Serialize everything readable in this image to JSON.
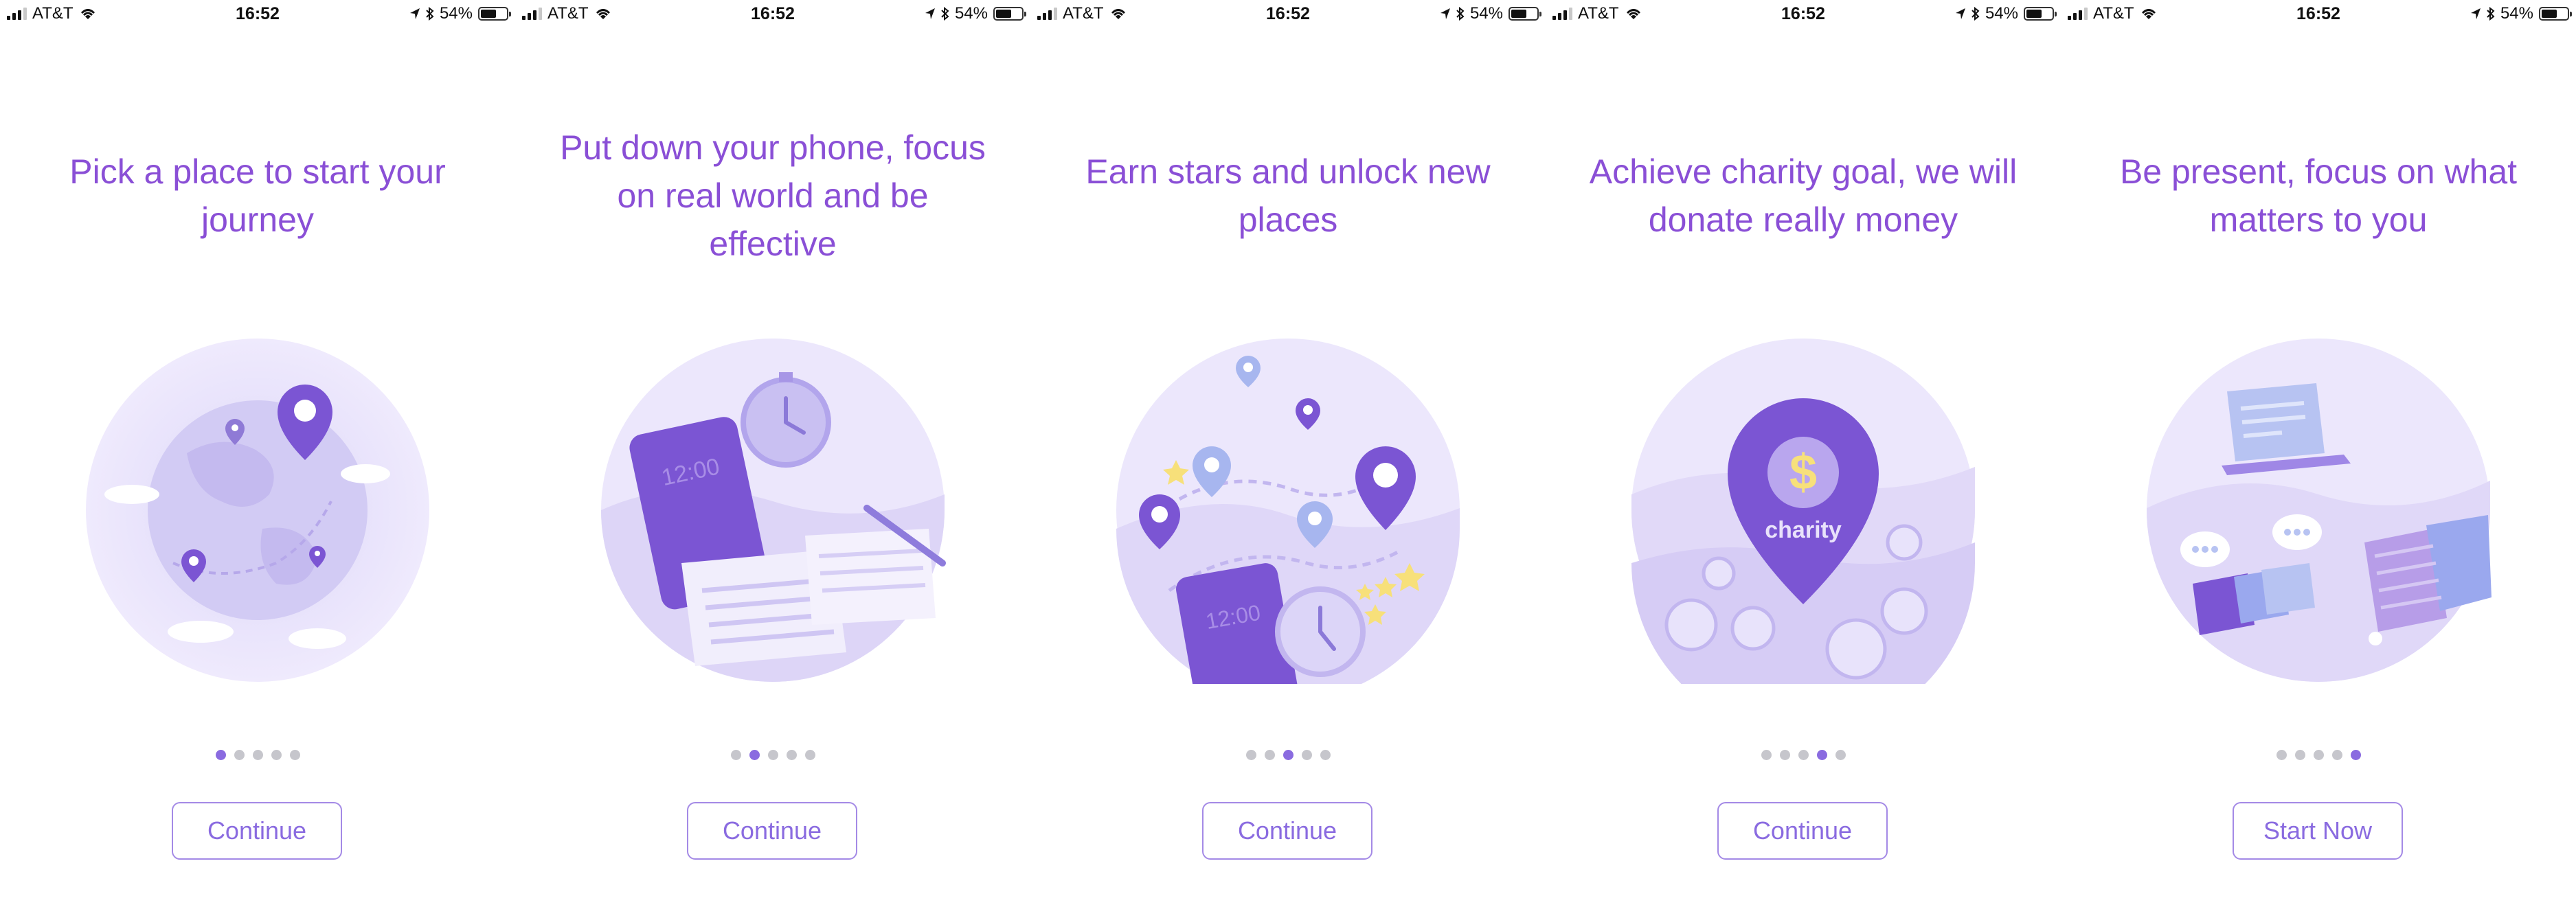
{
  "status_bar": {
    "carrier": "AT&T",
    "time": "16:52",
    "battery": "54%",
    "battery_level": 0.54,
    "icons": [
      "signal-icon",
      "wifi-icon",
      "location-arrow-icon",
      "bluetooth-icon",
      "battery-icon"
    ]
  },
  "screens": [
    {
      "title": "Pick a place to start your journey",
      "illustration": "globe-with-pins",
      "active_dot": 0,
      "button_label": "Continue"
    },
    {
      "title": "Put down your phone, focus on real world and be effective",
      "illustration": "phone-and-stopwatch",
      "phone_text": "12:00",
      "active_dot": 1,
      "button_label": "Continue"
    },
    {
      "title": "Earn stars and unlock new places",
      "illustration": "map-pins-and-stars",
      "phone_text": "12:00",
      "active_dot": 2,
      "button_label": "Continue"
    },
    {
      "title": "Achieve charity goal, we will donate really money",
      "illustration": "charity-pin",
      "pin_symbol": "$",
      "pin_label": "charity",
      "active_dot": 3,
      "button_label": "Continue"
    },
    {
      "title": "Be present, focus on what matters to you",
      "illustration": "laptop-and-coffee",
      "active_dot": 4,
      "button_label": "Start Now"
    }
  ],
  "page_indicator_count": 5,
  "colors": {
    "accent": "#8a4fd6",
    "button_border": "#a48ae6",
    "dot_active": "#8a6be0",
    "dot_inactive": "#c6c6cc",
    "illustration_bg": "#e9e4fb",
    "pin": "#7b55d3"
  }
}
